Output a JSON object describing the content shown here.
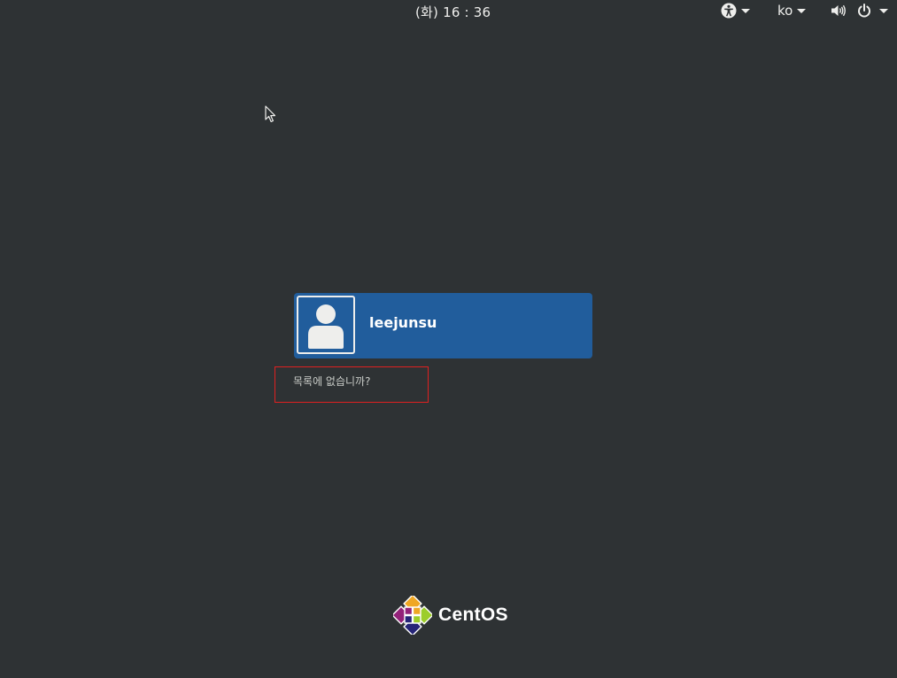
{
  "topbar": {
    "clock": "(화) 16 : 36",
    "accessibility_icon": "accessibility-icon",
    "language": "ko",
    "volume_icon": "speaker-icon",
    "power_icon": "power-icon"
  },
  "login": {
    "user_name": "leejunsu",
    "avatar_icon": "user-avatar-icon",
    "not_listed_label": "목록에 없습니까?",
    "highlight_color": "#e02020"
  },
  "branding": {
    "logo_icon": "centos-logo-icon",
    "logo_text": "CentOS"
  },
  "colors": {
    "background": "#2e3234",
    "user_card": "#215d9c",
    "text": "#eeeeec"
  }
}
